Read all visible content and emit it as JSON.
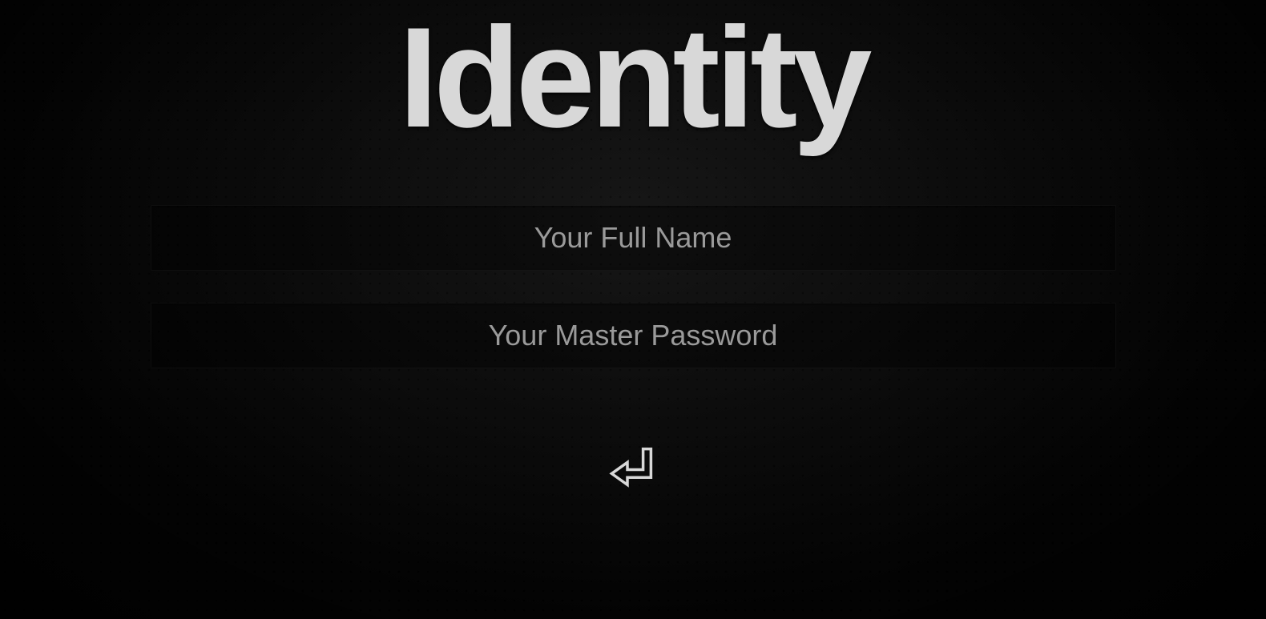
{
  "header": {
    "title": "Identity"
  },
  "form": {
    "fullname": {
      "placeholder": "Your Full Name",
      "value": ""
    },
    "password": {
      "placeholder": "Your Master Password",
      "value": ""
    }
  },
  "icons": {
    "submit": "return-arrow-icon"
  }
}
